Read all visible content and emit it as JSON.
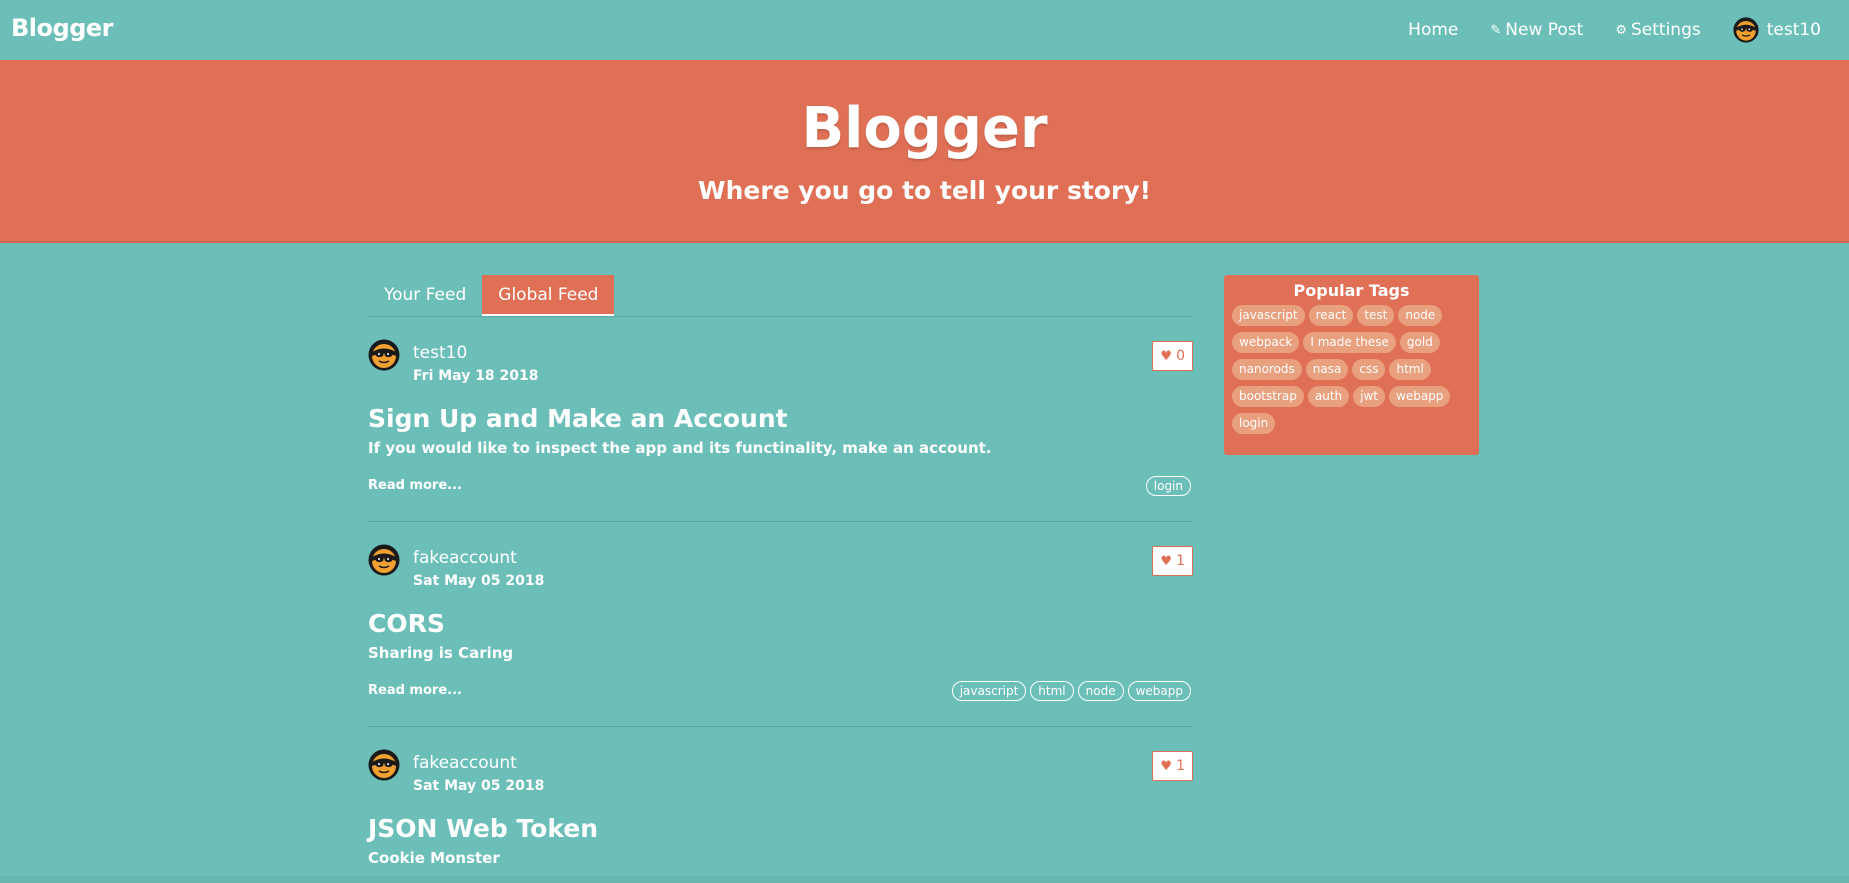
{
  "navbar": {
    "brand": "Blogger",
    "links": {
      "home": "Home",
      "new_post": "New Post",
      "settings": "Settings",
      "username": "test10"
    },
    "icons": {
      "new_post": "edit-icon",
      "settings": "gear-icon",
      "user": "avatar"
    }
  },
  "banner": {
    "title": "Blogger",
    "subtitle": "Where you go to tell your story!"
  },
  "tabs": {
    "your_feed": "Your Feed",
    "global_feed": "Global Feed",
    "active": "Global Feed"
  },
  "articles": [
    {
      "author": "test10",
      "date": "Fri May 18 2018",
      "likes": "0",
      "title": "Sign Up and Make an Account",
      "description": "If you would like to inspect the app and its functinality, make an account.",
      "read_more": "Read more...",
      "tags": [
        "login"
      ]
    },
    {
      "author": "fakeaccount",
      "date": "Sat May 05 2018",
      "likes": "1",
      "title": "CORS",
      "description": "Sharing is Caring",
      "read_more": "Read more...",
      "tags": [
        "javascript",
        "html",
        "node",
        "webapp"
      ]
    },
    {
      "author": "fakeaccount",
      "date": "Sat May 05 2018",
      "likes": "1",
      "title": "JSON Web Token",
      "description": "Cookie Monster"
    }
  ],
  "sidebar": {
    "title": "Popular Tags",
    "tags": [
      "javascript",
      "react",
      "test",
      "node",
      "webpack",
      "I made these",
      "gold",
      "nanorods",
      "nasa",
      "css",
      "html",
      "bootstrap",
      "auth",
      "jwt",
      "webapp",
      "login"
    ]
  },
  "colors": {
    "background": "#6cbfb8",
    "accent": "#e07055",
    "tag_pill": "#e9a07e",
    "text": "#ffffff"
  }
}
